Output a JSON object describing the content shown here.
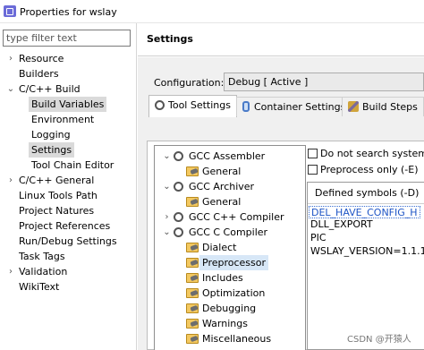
{
  "window": {
    "title": "Properties for wslay"
  },
  "filter": {
    "placeholder": "type filter text"
  },
  "nav": {
    "items": [
      {
        "label": "Resource"
      },
      {
        "label": "Builders"
      },
      {
        "label": "C/C++ Build"
      },
      {
        "label": "Build Variables"
      },
      {
        "label": "Environment"
      },
      {
        "label": "Logging"
      },
      {
        "label": "Settings"
      },
      {
        "label": "Tool Chain Editor"
      },
      {
        "label": "C/C++ General"
      },
      {
        "label": "Linux Tools Path"
      },
      {
        "label": "Project Natures"
      },
      {
        "label": "Project References"
      },
      {
        "label": "Run/Debug Settings"
      },
      {
        "label": "Task Tags"
      },
      {
        "label": "Validation"
      },
      {
        "label": "WikiText"
      }
    ]
  },
  "page": {
    "title": "Settings"
  },
  "configuration": {
    "label": "Configuration:",
    "value": "Debug  [ Active ]"
  },
  "tabs": [
    {
      "label": "Tool Settings"
    },
    {
      "label": "Container Settings"
    },
    {
      "label": "Build Steps"
    }
  ],
  "tool_tree": [
    {
      "label": "GCC Assembler"
    },
    {
      "label": "General"
    },
    {
      "label": "GCC Archiver"
    },
    {
      "label": "General"
    },
    {
      "label": "GCC C++ Compiler"
    },
    {
      "label": "GCC C Compiler"
    },
    {
      "label": "Dialect"
    },
    {
      "label": "Preprocessor"
    },
    {
      "label": "Includes"
    },
    {
      "label": "Optimization"
    },
    {
      "label": "Debugging"
    },
    {
      "label": "Warnings"
    },
    {
      "label": "Miscellaneous"
    }
  ],
  "options": {
    "no_search": "Do not search system d",
    "preprocess_only": "Preprocess only (-E)"
  },
  "symbols": {
    "header": "Defined symbols (-D)",
    "items": [
      "DEL_HAVE_CONFIG_H",
      "DLL_EXPORT",
      "PIC",
      "WSLAY_VERSION=1.1.1"
    ]
  },
  "watermark": "CSDN @开猿人"
}
